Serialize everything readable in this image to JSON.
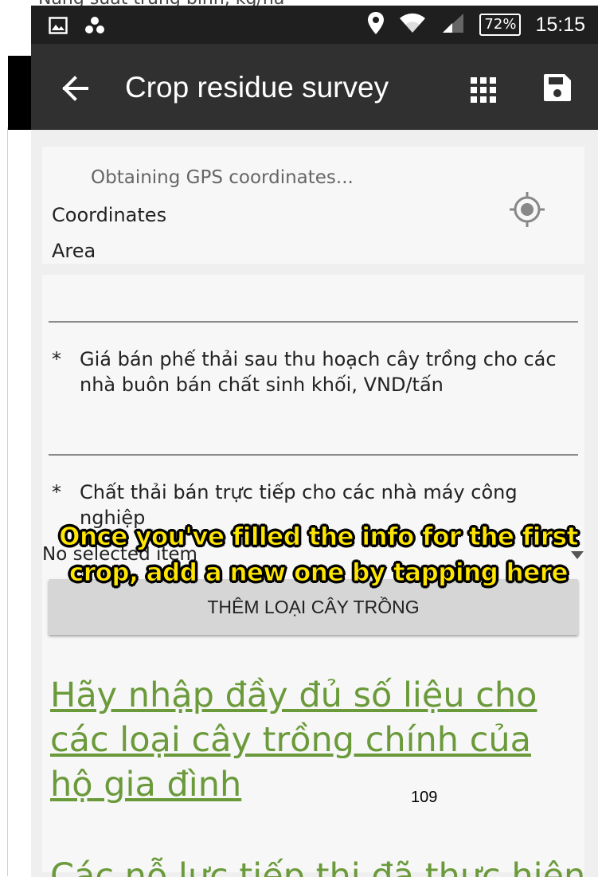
{
  "background": {
    "fragment_text": "*  Năng suất trung bình, kg/ha"
  },
  "status_bar": {
    "battery": "72%",
    "time": "15:15",
    "icons": [
      "image-icon",
      "dots-icon",
      "location-icon",
      "wifi-icon",
      "signal-icon",
      "battery-icon"
    ]
  },
  "app_bar": {
    "title": "Crop residue survey",
    "icons": [
      "back-arrow-icon",
      "grid-icon",
      "save-icon"
    ]
  },
  "gps": {
    "status": "Obtaining GPS coordinates...",
    "coordinates_label": "Coordinates",
    "area_label": "Area"
  },
  "form": {
    "q1_star": "*",
    "q1_label": "Giá bán phế thải sau thu hoạch cây trồng cho các nhà buôn bán chất sinh khối, VND/tấn",
    "q2_star": "*",
    "q2_label": "Chất thải bán trực tiếp cho các nhà máy công nghiệp",
    "dropdown_value": "No selected item",
    "add_crop_button": "THÊM LOẠI CÂY TRỒNG",
    "hint_link": "Hãy nhập đầy đủ số liệu cho các loại cây trồng chính của hộ gia đình",
    "bottom_link": "Các nỗ lực tiếp thị đã thực hiện"
  },
  "overlay": {
    "caption": "Once you've filled the info for the first crop, add a new one by tapping here"
  },
  "page_number": "109",
  "colors": {
    "status_bar": "#1f1f1f",
    "app_bar": "#303030",
    "link_green": "#6a9a3a",
    "caption_yellow": "#ffe600"
  }
}
